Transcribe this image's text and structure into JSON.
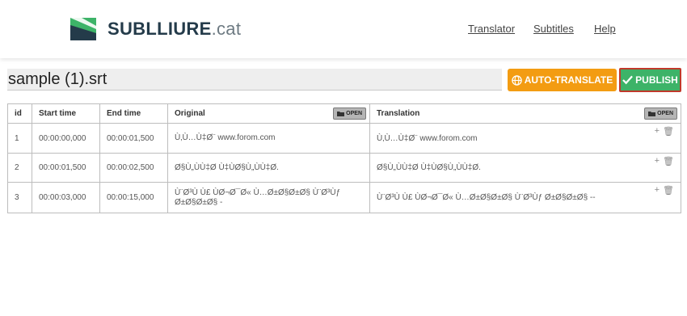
{
  "brand": {
    "name": "SUBLLIURE",
    "tld": ".cat"
  },
  "nav": [
    "Translator",
    "Subtitles",
    "Help"
  ],
  "file": {
    "name": "sample (1).srt"
  },
  "actions": {
    "auto_translate": "AUTO-TRANSLATE",
    "publish": "PUBLISH"
  },
  "colors": {
    "brand_green": "#3db368",
    "brand_dark": "#243b4a",
    "auto_translate": "#f39c12",
    "publish": "#3db368",
    "publish_border": "#c0392b"
  },
  "table": {
    "headers": {
      "id": "id",
      "start": "Start time",
      "end": "End time",
      "original": "Original",
      "translation": "Translation"
    },
    "open_label": "OPEN",
    "rows": [
      {
        "id": "1",
        "start": "00:00:00,000",
        "end": "00:00:01,500",
        "original": "Ù‚Ù…Ù‡Ø¨ www.forom.com",
        "translation": "Ù‚Ù…Ù‡Ø¨ www.forom.com"
      },
      {
        "id": "2",
        "start": "00:00:01,500",
        "end": "00:00:02,500",
        "original": "Ø§Ù„ÙÙ‡Ø Ù‡ÙØ§Ù„ÙÙ‡Ø.",
        "translation": "Ø§Ù„ÙÙ‡Ø Ù‡ÙØ§Ù„ÙÙ‡Ø."
      },
      {
        "id": "3",
        "start": "00:00:03,000",
        "end": "00:00:15,000",
        "original": "Ù¨Ø³Ù Ù£ ÙØ¬Ø¯Ø« Ù…Ø±Ø§Ø±Ø§ Ù¨Ø³Ùƒ Ø±Ø§Ø±Ø§ -",
        "translation": "Ù¨Ø³Ù Ù£ ÙØ¬Ø¯Ø« Ù…Ø±Ø§Ø±Ø§ Ù¨Ø³Ùƒ Ø±Ø§Ø±Ø§ --"
      }
    ],
    "row_action_icons": [
      "plus-icon",
      "trash-icon"
    ]
  }
}
